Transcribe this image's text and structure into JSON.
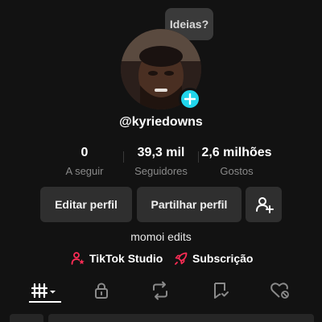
{
  "tooltip": {
    "text": "Ideias?"
  },
  "profile": {
    "username": "@kyriedowns",
    "bio": "momoi edits"
  },
  "stats": [
    {
      "value": "0",
      "label": "A seguir"
    },
    {
      "value": "39,3 mil",
      "label": "Seguidores"
    },
    {
      "value": "2,6 milhões",
      "label": "Gostos"
    }
  ],
  "buttons": {
    "edit": "Editar perfil",
    "share": "Partilhar perfil",
    "follow_icon": "add-person-icon"
  },
  "links": {
    "studio": "TikTok Studio",
    "subscription": "Subscrição"
  },
  "tabs": [
    "videos-grid-icon",
    "lock-icon",
    "repost-icon",
    "saved-icon",
    "liked-icon"
  ],
  "colors": {
    "background": "#121212",
    "accent_cyan": "#20d5ec",
    "accent_red": "#fe2c55",
    "button_bg": "#2f2f2f"
  }
}
